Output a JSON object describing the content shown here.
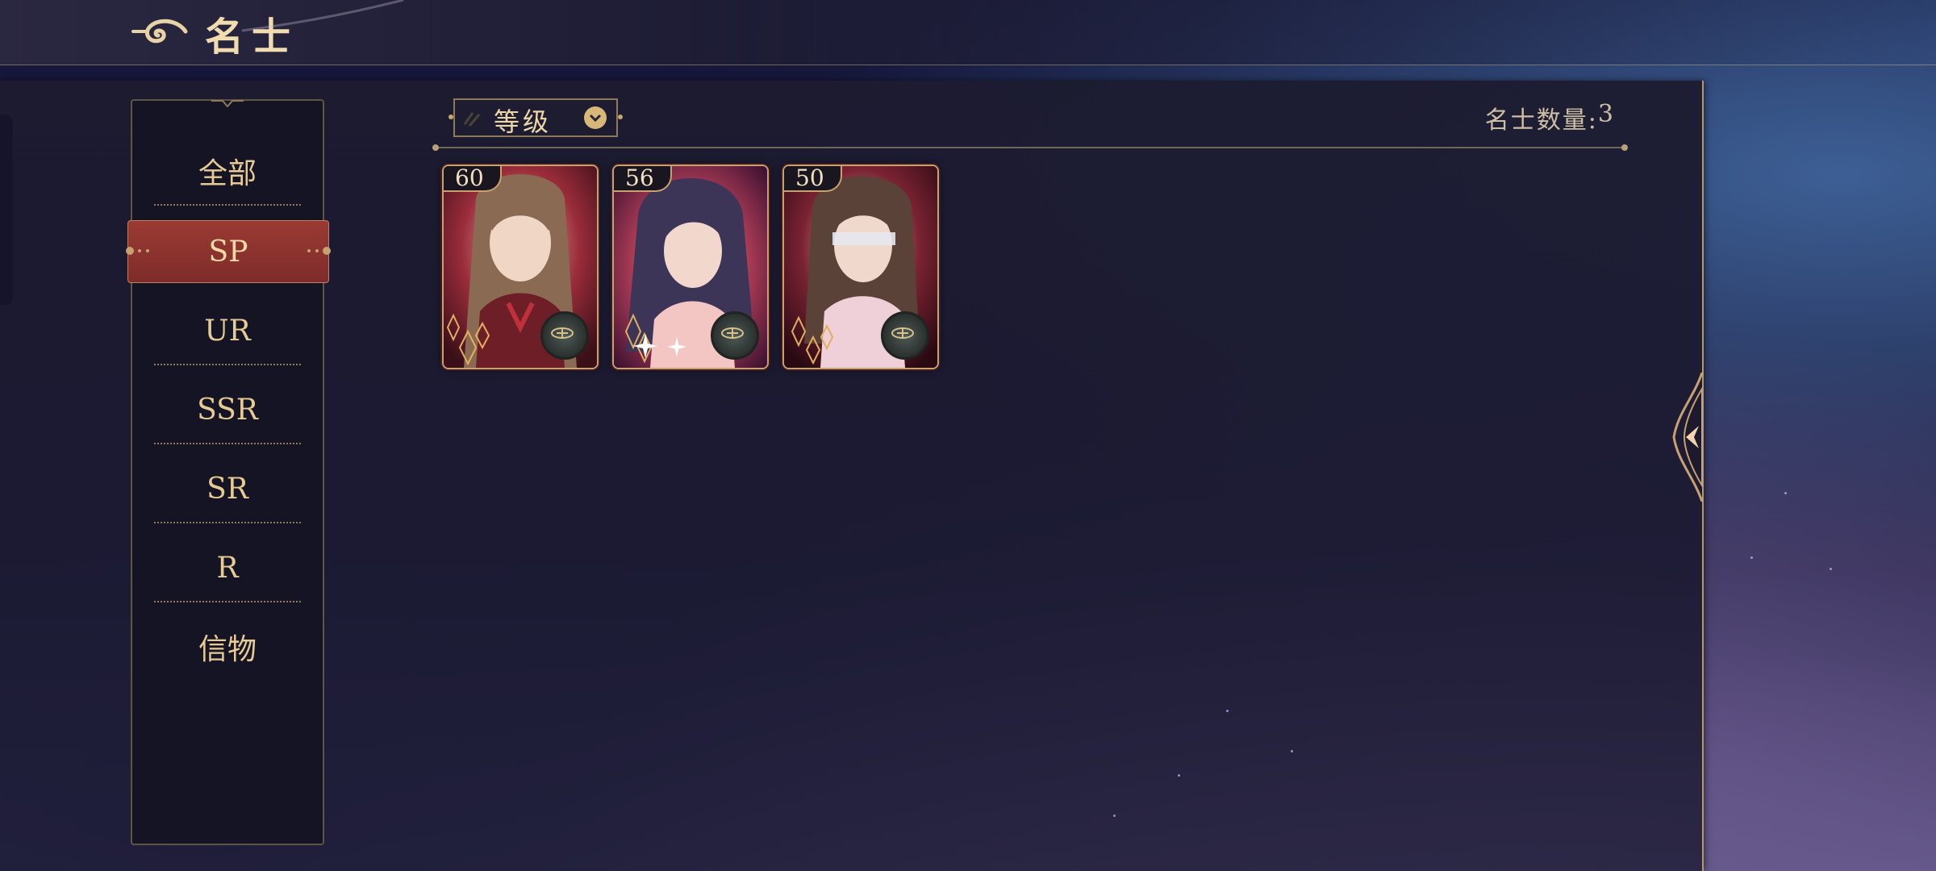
{
  "header": {
    "title": "名士"
  },
  "sidebar": {
    "items": [
      {
        "label": "全部"
      },
      {
        "label": "SP",
        "active": true
      },
      {
        "label": "UR"
      },
      {
        "label": "SSR"
      },
      {
        "label": "SR"
      },
      {
        "label": "R"
      },
      {
        "label": "信物"
      }
    ]
  },
  "filter": {
    "selected": "等级"
  },
  "summary": {
    "count_label": "名士数量:",
    "count_value": "3"
  },
  "cards": [
    {
      "level": "60",
      "hair": "#8a6a52",
      "bg": "#9a2c3a"
    },
    {
      "level": "56",
      "hair": "#3d3558",
      "bg": "#a83a55"
    },
    {
      "level": "50",
      "hair": "#5a4238",
      "bg": "#7a2232"
    }
  ],
  "colors": {
    "accent": "#d8b878",
    "active": "#8e3430",
    "text": "#e6cb94"
  }
}
